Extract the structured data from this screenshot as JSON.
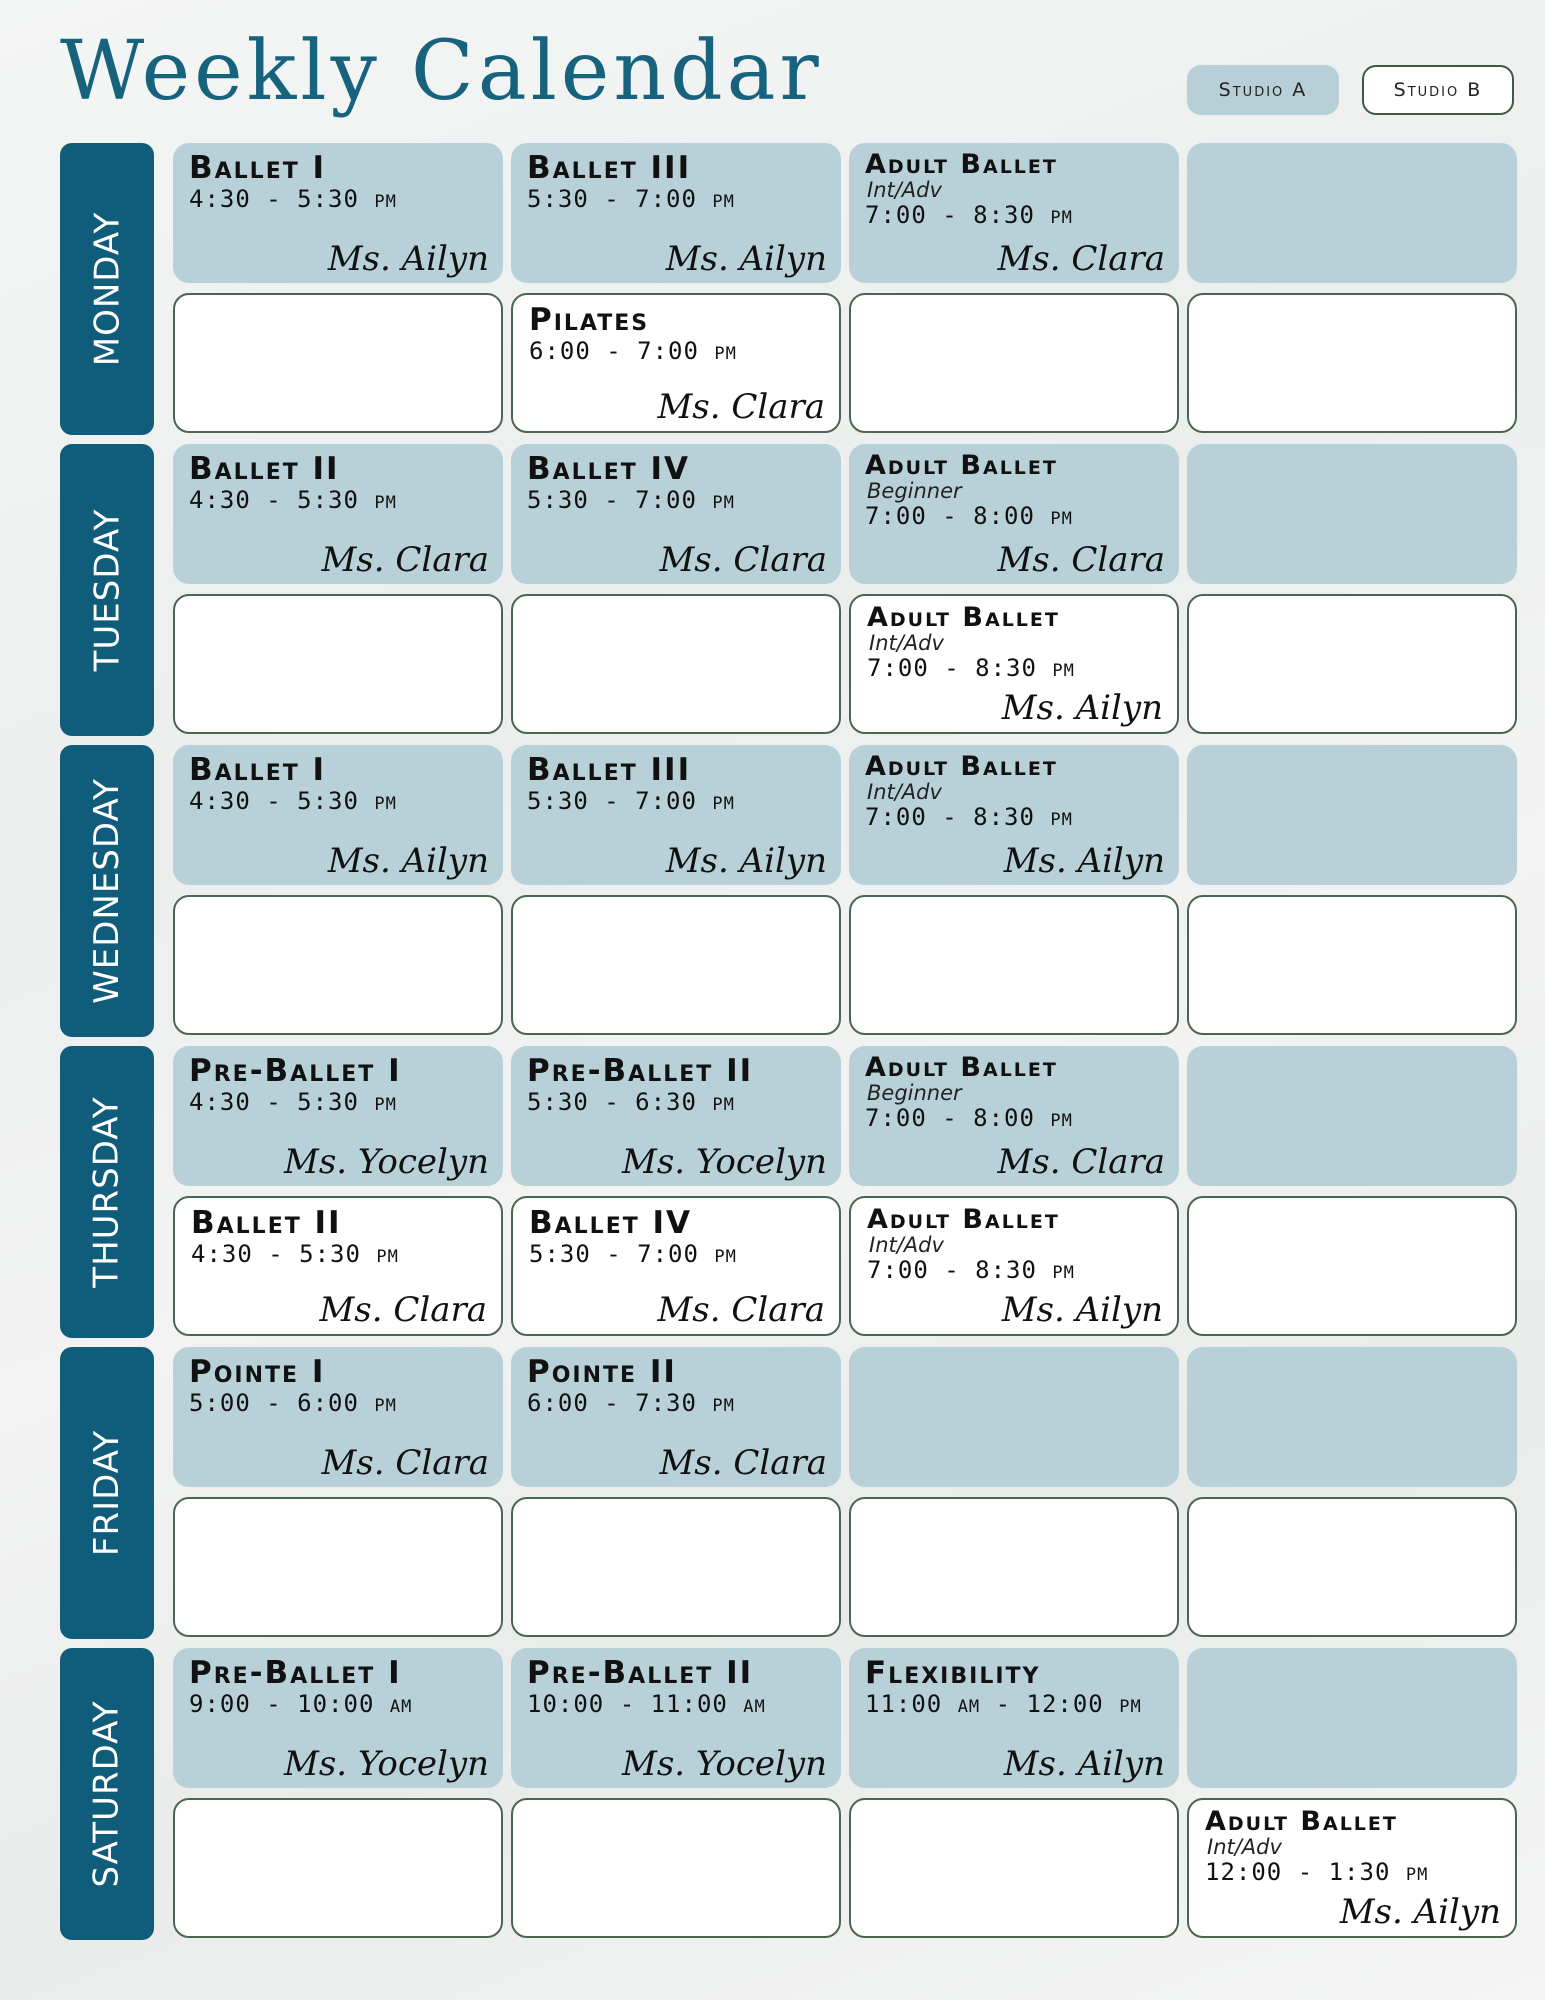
{
  "title": "Weekly Calendar",
  "legend": {
    "studio_a": "Studio A",
    "studio_b": "Studio B"
  },
  "colors": {
    "studio_a": "#b8d1d8",
    "studio_b": "#ffffff",
    "day_tab": "#0f5c7b",
    "title": "#17627c"
  },
  "days": [
    {
      "label": "MONDAY",
      "studio_a": [
        {
          "name": "Ballet I",
          "time": "4:30 - 5:30 pm",
          "teacher": "Ms. Ailyn"
        },
        {
          "name": "Ballet III",
          "time": "5:30 - 7:00 pm",
          "teacher": "Ms. Ailyn"
        },
        {
          "name": "Adult Ballet",
          "level": "Int/Adv",
          "time": "7:00 - 8:30 pm",
          "teacher": "Ms. Clara"
        },
        null
      ],
      "studio_b": [
        null,
        {
          "name": "Pilates",
          "time": "6:00 - 7:00 pm",
          "teacher": "Ms. Clara"
        },
        null,
        null
      ]
    },
    {
      "label": "TUESDAY",
      "studio_a": [
        {
          "name": "Ballet II",
          "time": "4:30 - 5:30 pm",
          "teacher": "Ms. Clara"
        },
        {
          "name": "Ballet IV",
          "time": "5:30 - 7:00 pm",
          "teacher": "Ms. Clara"
        },
        {
          "name": "Adult Ballet",
          "level": "Beginner",
          "time": "7:00 - 8:00 pm",
          "teacher": "Ms. Clara"
        },
        null
      ],
      "studio_b": [
        null,
        null,
        {
          "name": "Adult Ballet",
          "level": "Int/Adv",
          "time": "7:00 - 8:30 pm",
          "teacher": "Ms. Ailyn"
        },
        null
      ]
    },
    {
      "label": "WEDNESDAY",
      "studio_a": [
        {
          "name": "Ballet I",
          "time": "4:30 - 5:30 pm",
          "teacher": "Ms. Ailyn"
        },
        {
          "name": "Ballet III",
          "time": "5:30 - 7:00 pm",
          "teacher": "Ms. Ailyn"
        },
        {
          "name": "Adult Ballet",
          "level": "Int/Adv",
          "time": "7:00 - 8:30 pm",
          "teacher": "Ms. Ailyn"
        },
        null
      ],
      "studio_b": [
        null,
        null,
        null,
        null
      ]
    },
    {
      "label": "THURSDAY",
      "studio_a": [
        {
          "name": "Pre-Ballet I",
          "time": "4:30 - 5:30 pm",
          "teacher": "Ms. Yocelyn"
        },
        {
          "name": "Pre-Ballet II",
          "time": "5:30 - 6:30 pm",
          "teacher": "Ms. Yocelyn"
        },
        {
          "name": "Adult Ballet",
          "level": "Beginner",
          "time": "7:00 - 8:00 pm",
          "teacher": "Ms. Clara"
        },
        null
      ],
      "studio_b": [
        {
          "name": "Ballet II",
          "time": "4:30 - 5:30 pm",
          "teacher": "Ms. Clara"
        },
        {
          "name": "Ballet IV",
          "time": "5:30 - 7:00 pm",
          "teacher": "Ms. Clara"
        },
        {
          "name": "Adult Ballet",
          "level": "Int/Adv",
          "time": "7:00 - 8:30 pm",
          "teacher": "Ms. Ailyn"
        },
        null
      ]
    },
    {
      "label": "FRIDAY",
      "studio_a": [
        {
          "name": "Pointe I",
          "time": "5:00 - 6:00 pm",
          "teacher": "Ms. Clara"
        },
        {
          "name": "Pointe II",
          "time": "6:00 - 7:30 pm",
          "teacher": "Ms. Clara"
        },
        null,
        null
      ],
      "studio_b": [
        null,
        null,
        null,
        null
      ]
    },
    {
      "label": "SATURDAY",
      "studio_a": [
        {
          "name": "Pre-Ballet I",
          "time": "9:00 - 10:00 am",
          "teacher": "Ms. Yocelyn"
        },
        {
          "name": "Pre-Ballet II",
          "time": "10:00 - 11:00 am",
          "teacher": "Ms. Yocelyn"
        },
        {
          "name": "Flexibility",
          "time": "11:00 am - 12:00 pm",
          "teacher": "Ms. Ailyn"
        },
        null
      ],
      "studio_b": [
        null,
        null,
        null,
        {
          "name": "Adult Ballet",
          "level": "Int/Adv",
          "time": "12:00 - 1:30 pm",
          "teacher": "Ms. Ailyn"
        }
      ]
    }
  ]
}
